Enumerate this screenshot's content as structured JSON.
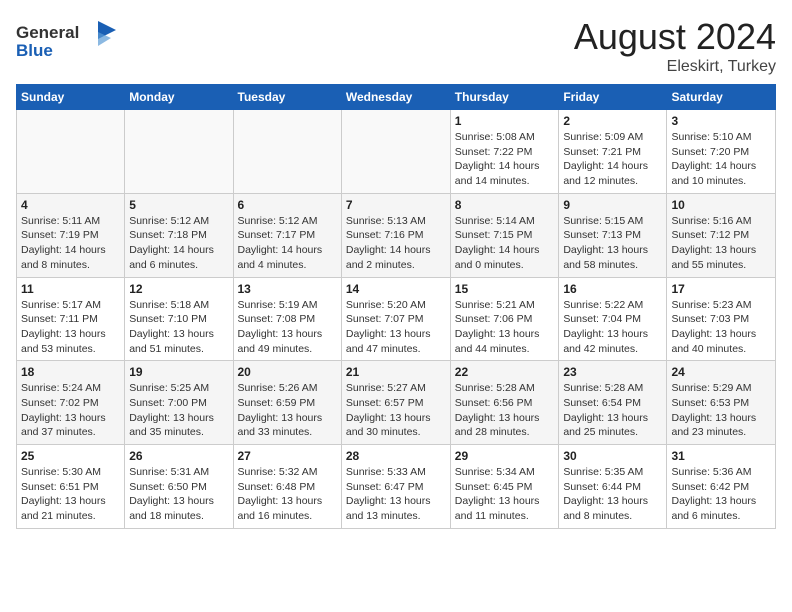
{
  "header": {
    "logo_general": "General",
    "logo_blue": "Blue",
    "month_year": "August 2024",
    "location": "Eleskirt, Turkey"
  },
  "calendar": {
    "days_of_week": [
      "Sunday",
      "Monday",
      "Tuesday",
      "Wednesday",
      "Thursday",
      "Friday",
      "Saturday"
    ],
    "weeks": [
      {
        "days": [
          {
            "number": "",
            "info": ""
          },
          {
            "number": "",
            "info": ""
          },
          {
            "number": "",
            "info": ""
          },
          {
            "number": "",
            "info": ""
          },
          {
            "number": "1",
            "info": "Sunrise: 5:08 AM\nSunset: 7:22 PM\nDaylight: 14 hours\nand 14 minutes."
          },
          {
            "number": "2",
            "info": "Sunrise: 5:09 AM\nSunset: 7:21 PM\nDaylight: 14 hours\nand 12 minutes."
          },
          {
            "number": "3",
            "info": "Sunrise: 5:10 AM\nSunset: 7:20 PM\nDaylight: 14 hours\nand 10 minutes."
          }
        ]
      },
      {
        "days": [
          {
            "number": "4",
            "info": "Sunrise: 5:11 AM\nSunset: 7:19 PM\nDaylight: 14 hours\nand 8 minutes."
          },
          {
            "number": "5",
            "info": "Sunrise: 5:12 AM\nSunset: 7:18 PM\nDaylight: 14 hours\nand 6 minutes."
          },
          {
            "number": "6",
            "info": "Sunrise: 5:12 AM\nSunset: 7:17 PM\nDaylight: 14 hours\nand 4 minutes."
          },
          {
            "number": "7",
            "info": "Sunrise: 5:13 AM\nSunset: 7:16 PM\nDaylight: 14 hours\nand 2 minutes."
          },
          {
            "number": "8",
            "info": "Sunrise: 5:14 AM\nSunset: 7:15 PM\nDaylight: 14 hours\nand 0 minutes."
          },
          {
            "number": "9",
            "info": "Sunrise: 5:15 AM\nSunset: 7:13 PM\nDaylight: 13 hours\nand 58 minutes."
          },
          {
            "number": "10",
            "info": "Sunrise: 5:16 AM\nSunset: 7:12 PM\nDaylight: 13 hours\nand 55 minutes."
          }
        ]
      },
      {
        "days": [
          {
            "number": "11",
            "info": "Sunrise: 5:17 AM\nSunset: 7:11 PM\nDaylight: 13 hours\nand 53 minutes."
          },
          {
            "number": "12",
            "info": "Sunrise: 5:18 AM\nSunset: 7:10 PM\nDaylight: 13 hours\nand 51 minutes."
          },
          {
            "number": "13",
            "info": "Sunrise: 5:19 AM\nSunset: 7:08 PM\nDaylight: 13 hours\nand 49 minutes."
          },
          {
            "number": "14",
            "info": "Sunrise: 5:20 AM\nSunset: 7:07 PM\nDaylight: 13 hours\nand 47 minutes."
          },
          {
            "number": "15",
            "info": "Sunrise: 5:21 AM\nSunset: 7:06 PM\nDaylight: 13 hours\nand 44 minutes."
          },
          {
            "number": "16",
            "info": "Sunrise: 5:22 AM\nSunset: 7:04 PM\nDaylight: 13 hours\nand 42 minutes."
          },
          {
            "number": "17",
            "info": "Sunrise: 5:23 AM\nSunset: 7:03 PM\nDaylight: 13 hours\nand 40 minutes."
          }
        ]
      },
      {
        "days": [
          {
            "number": "18",
            "info": "Sunrise: 5:24 AM\nSunset: 7:02 PM\nDaylight: 13 hours\nand 37 minutes."
          },
          {
            "number": "19",
            "info": "Sunrise: 5:25 AM\nSunset: 7:00 PM\nDaylight: 13 hours\nand 35 minutes."
          },
          {
            "number": "20",
            "info": "Sunrise: 5:26 AM\nSunset: 6:59 PM\nDaylight: 13 hours\nand 33 minutes."
          },
          {
            "number": "21",
            "info": "Sunrise: 5:27 AM\nSunset: 6:57 PM\nDaylight: 13 hours\nand 30 minutes."
          },
          {
            "number": "22",
            "info": "Sunrise: 5:28 AM\nSunset: 6:56 PM\nDaylight: 13 hours\nand 28 minutes."
          },
          {
            "number": "23",
            "info": "Sunrise: 5:28 AM\nSunset: 6:54 PM\nDaylight: 13 hours\nand 25 minutes."
          },
          {
            "number": "24",
            "info": "Sunrise: 5:29 AM\nSunset: 6:53 PM\nDaylight: 13 hours\nand 23 minutes."
          }
        ]
      },
      {
        "days": [
          {
            "number": "25",
            "info": "Sunrise: 5:30 AM\nSunset: 6:51 PM\nDaylight: 13 hours\nand 21 minutes."
          },
          {
            "number": "26",
            "info": "Sunrise: 5:31 AM\nSunset: 6:50 PM\nDaylight: 13 hours\nand 18 minutes."
          },
          {
            "number": "27",
            "info": "Sunrise: 5:32 AM\nSunset: 6:48 PM\nDaylight: 13 hours\nand 16 minutes."
          },
          {
            "number": "28",
            "info": "Sunrise: 5:33 AM\nSunset: 6:47 PM\nDaylight: 13 hours\nand 13 minutes."
          },
          {
            "number": "29",
            "info": "Sunrise: 5:34 AM\nSunset: 6:45 PM\nDaylight: 13 hours\nand 11 minutes."
          },
          {
            "number": "30",
            "info": "Sunrise: 5:35 AM\nSunset: 6:44 PM\nDaylight: 13 hours\nand 8 minutes."
          },
          {
            "number": "31",
            "info": "Sunrise: 5:36 AM\nSunset: 6:42 PM\nDaylight: 13 hours\nand 6 minutes."
          }
        ]
      }
    ]
  }
}
